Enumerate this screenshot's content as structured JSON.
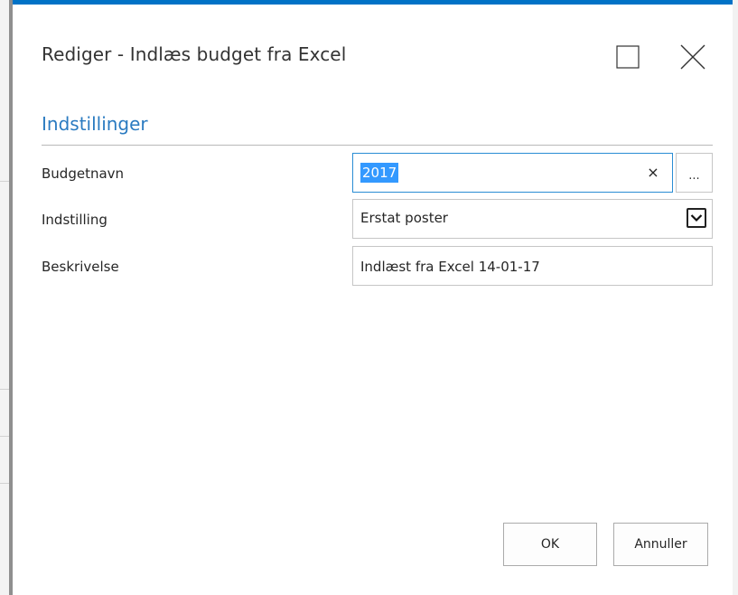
{
  "dialog": {
    "title": "Rediger - Indlæs budget fra Excel",
    "accent_color": "#0072c6",
    "header_icons": [
      "maximize-icon",
      "close-icon"
    ]
  },
  "section": {
    "title": "Indstillinger",
    "color": "#2b7bc1"
  },
  "fields": {
    "budget_name": {
      "label": "Budgetnavn",
      "value": "2017",
      "clear_glyph": "×",
      "lookup_label": "..."
    },
    "setting": {
      "label": "Indstilling",
      "value": "Erstat poster"
    },
    "description": {
      "label": "Beskrivelse",
      "value": "Indlæst fra Excel 14-01-17"
    }
  },
  "buttons": {
    "ok": "OK",
    "cancel": "Annuller"
  }
}
